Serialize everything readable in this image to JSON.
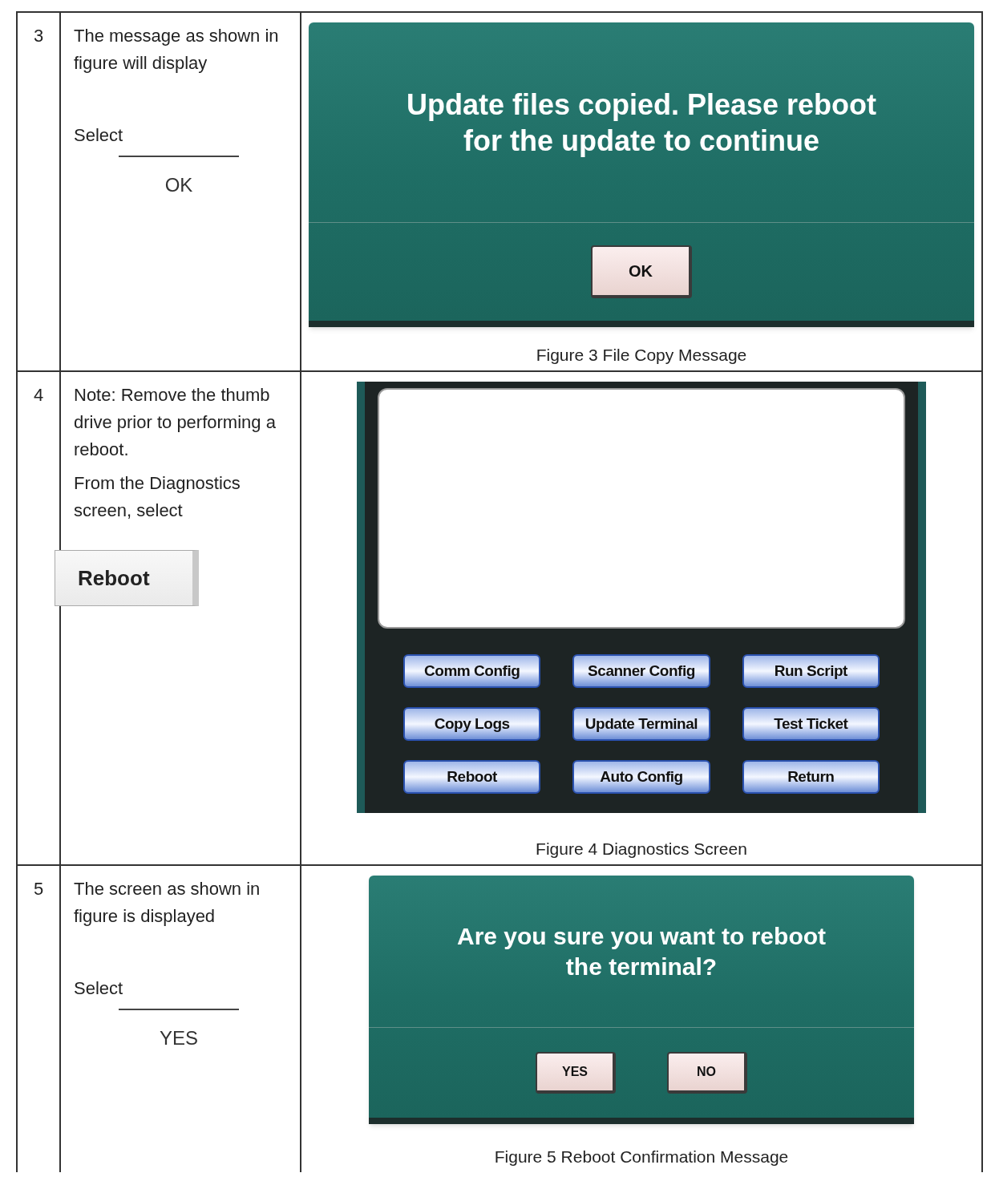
{
  "steps": [
    {
      "number": "3",
      "paragraphs": [
        "The message as shown in figure will display"
      ],
      "select_label": "Select",
      "answer": "OK",
      "figure": {
        "kind": "message",
        "message": "Update files copied. Please reboot for the update to continue",
        "buttons": [
          "OK"
        ]
      },
      "caption": "Figure 3 File Copy Message"
    },
    {
      "number": "4",
      "paragraphs": [
        "Note: Remove the thumb drive prior to performing a reboot.",
        "From the Diagnostics screen, select"
      ],
      "button_image": "Reboot",
      "figure": {
        "kind": "diagnostics",
        "buttons": [
          "Comm Config",
          "Scanner Config",
          "Run Script",
          "Copy Logs",
          "Update Terminal",
          "Test Ticket",
          "Reboot",
          "Auto Config",
          "Return"
        ]
      },
      "caption": "Figure 4 Diagnostics Screen"
    },
    {
      "number": "5",
      "paragraphs": [
        "The screen as shown in figure is displayed"
      ],
      "select_label": "Select",
      "answer": "YES",
      "figure": {
        "kind": "message",
        "message": "Are you sure you want to reboot the terminal?",
        "buttons": [
          "YES",
          "NO"
        ]
      },
      "caption": "Figure 5 Reboot Confirmation Message"
    }
  ]
}
